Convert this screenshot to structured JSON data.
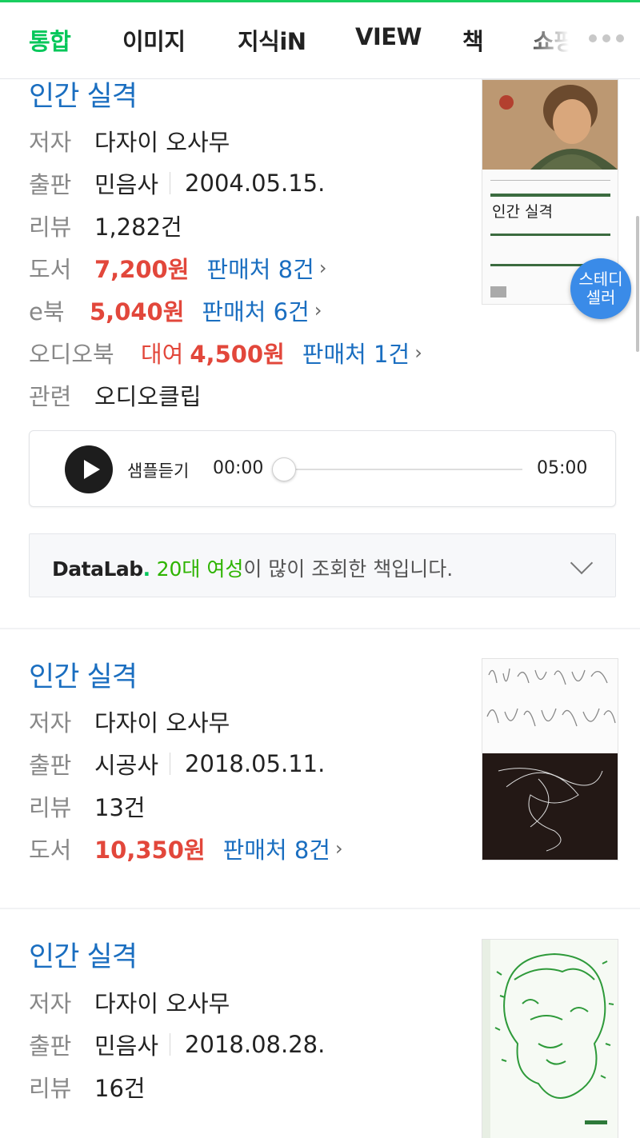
{
  "tabs": [
    {
      "label": "통합",
      "active": true
    },
    {
      "label": "이미지"
    },
    {
      "label": "지식iN"
    },
    {
      "label": "VIEW"
    },
    {
      "label": "책"
    },
    {
      "label": "쇼핑"
    }
  ],
  "labels": {
    "author": "저자",
    "publisher": "출판",
    "review": "리뷰",
    "book": "도서",
    "ebook": "e북",
    "audiobook": "오디오북",
    "related": "관련",
    "sellers": "판매처"
  },
  "books": [
    {
      "title": "인간 실격",
      "author": "다자이 오사무",
      "publisher": "민음사",
      "date": "2004.05.15.",
      "review": "1,282건",
      "price_book": "7,200원",
      "sellers_book": "판매처 8건",
      "price_ebook": "5,040원",
      "sellers_ebook": "판매처 6건",
      "audio_rent": "대여",
      "price_audio": "4,500원",
      "sellers_audio": "판매처 1건",
      "related": "오디오클립",
      "badge": "스테디\n셀러",
      "cover_title": "인간 실격"
    },
    {
      "title": "인간 실격",
      "author": "다자이 오사무",
      "publisher": "시공사",
      "date": "2018.05.11.",
      "review": "13건",
      "price_book": "10,350원",
      "sellers_book": "판매처 8건"
    },
    {
      "title": "인간 실격",
      "author": "다자이 오사무",
      "publisher": "민음사",
      "date": "2018.08.28.",
      "review": "16건"
    }
  ],
  "player": {
    "label": "샘플듣기",
    "current": "00:00",
    "total": "05:00",
    "progress": 0
  },
  "datalab": {
    "brand": "DataLab",
    "dot": ".",
    "highlight": "20대 여성",
    "text": "이 많이 조회한 책입니다."
  },
  "colors": {
    "accent": "#03c75a",
    "link": "#1a6ec0",
    "price": "#e2473b"
  }
}
